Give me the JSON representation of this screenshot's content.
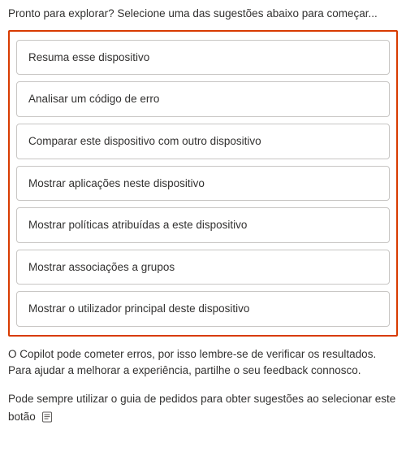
{
  "intro": "Pronto para explorar? Selecione uma das sugestões abaixo para começar...",
  "suggestions": [
    {
      "label": "Resuma esse dispositivo"
    },
    {
      "label": "Analisar um código de erro"
    },
    {
      "label": "Comparar este dispositivo com outro dispositivo"
    },
    {
      "label": "Mostrar aplicações neste dispositivo"
    },
    {
      "label": "Mostrar políticas atribuídas a este dispositivo"
    },
    {
      "label": "Mostrar associações a grupos"
    },
    {
      "label": "Mostrar o utilizador principal deste dispositivo"
    }
  ],
  "disclaimer": "O Copilot pode cometer erros, por isso lembre-se de verificar os resultados. Para ajudar a melhorar a experiência, partilhe o seu feedback connosco.",
  "guide": {
    "text_before": "Pode sempre utilizar o guia de pedidos para obter sugestões ao selecionar este botão",
    "icon": "prompt-guide-icon"
  }
}
